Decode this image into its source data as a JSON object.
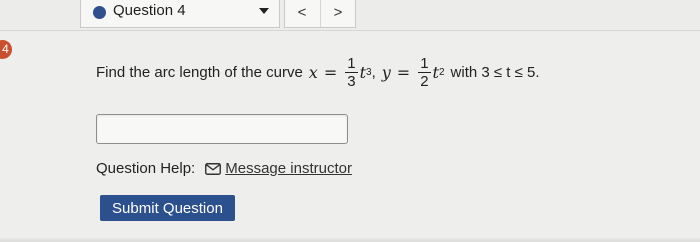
{
  "header": {
    "question_selector_label": "Question 4",
    "prev_label": "<",
    "next_label": ">"
  },
  "side_badge": "4",
  "question": {
    "prefix": "Find the arc length of the curve",
    "var_x": "x",
    "eq1": "=",
    "frac1_num": "1",
    "frac1_den": "3",
    "term1_base": "t",
    "term1_exp": "3",
    "comma": ",",
    "var_y": "y",
    "eq2": "=",
    "frac2_num": "1",
    "frac2_den": "2",
    "term2_base": "t",
    "term2_exp": "2",
    "suffix": "with 3 ≤ t ≤ 5."
  },
  "answer_input": {
    "value": "",
    "placeholder": ""
  },
  "help": {
    "label": "Question Help:",
    "link_label": "Message instructor"
  },
  "submit_label": "Submit Question",
  "colors": {
    "accent": "#2c4f8e",
    "badge": "#c8502e",
    "background": "#eeeeed"
  }
}
